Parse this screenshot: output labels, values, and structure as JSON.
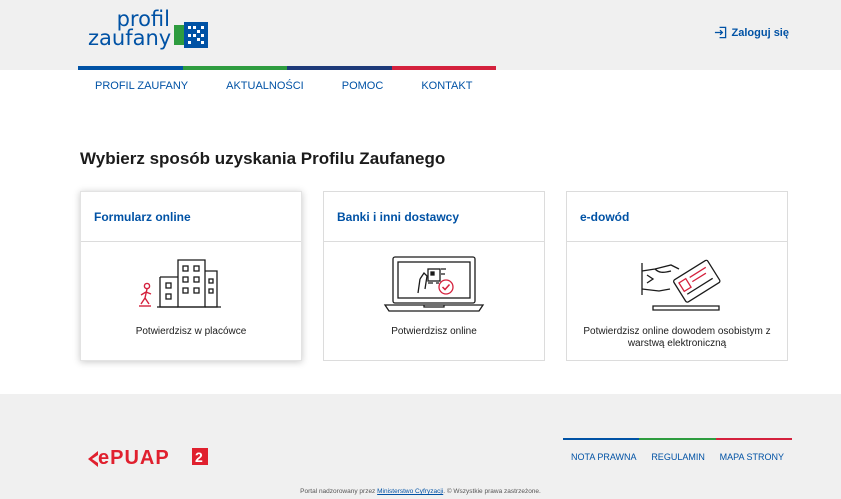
{
  "header": {
    "logo_line1": "profil",
    "logo_line2": "zaufany",
    "login_label": "Zaloguj się"
  },
  "nav": {
    "items": [
      {
        "label": "PROFIL ZAUFANY"
      },
      {
        "label": "AKTUALNOŚCI"
      },
      {
        "label": "POMOC"
      },
      {
        "label": "KONTAKT"
      }
    ]
  },
  "main": {
    "title": "Wybierz sposób uzyskania Profilu Zaufanego",
    "cards": [
      {
        "title": "Formularz online",
        "caption": "Potwierdzisz w placówce",
        "icon": "building-person-icon"
      },
      {
        "title": "Banki i inni dostawcy",
        "caption": "Potwierdzisz online",
        "icon": "laptop-check-icon"
      },
      {
        "title": "e-dowód",
        "caption": "Potwierdzisz online dowodem osobistym z warstwą elektroniczną",
        "icon": "id-card-reader-icon"
      }
    ]
  },
  "footer": {
    "logo": "ePUAP 2",
    "links": [
      {
        "label": "NOTA PRAWNA"
      },
      {
        "label": "REGULAMIN"
      },
      {
        "label": "MAPA STRONY"
      }
    ],
    "copy_prefix": "Portal nadzorowany przez ",
    "copy_link": "Ministerstwo Cyfryzacji",
    "copy_suffix": ". © Wszystkie prawa zastrzeżone."
  },
  "colors": {
    "brand_blue": "#0052a5",
    "accent_green": "#2e9c3f",
    "accent_navy": "#1d3a79",
    "accent_red": "#d4213d",
    "epuap_red": "#e0202e"
  }
}
